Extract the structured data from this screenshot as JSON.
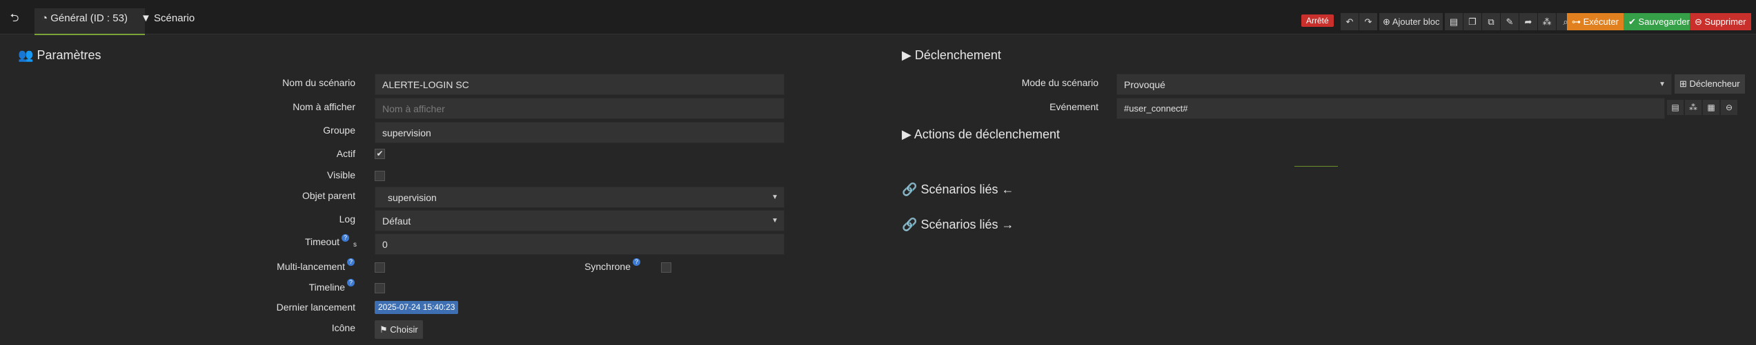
{
  "topbar": {
    "back_icon": "arrow-left-circle-icon",
    "tabs": [
      {
        "label": "Général (ID : 53)",
        "icon": "dashboard-icon"
      },
      {
        "label": "Scénario",
        "icon": "filter-icon"
      }
    ],
    "status": "Arrêté",
    "add_block_label": "Ajouter bloc",
    "execute_label": "Exécuter",
    "save_label": "Sauvegarder",
    "delete_label": "Supprimer"
  },
  "left": {
    "section_title": "Paramètres",
    "fields": {
      "name_label": "Nom du scénario",
      "name_value": "ALERTE-LOGIN SC",
      "display_label": "Nom à afficher",
      "display_placeholder": "Nom à afficher",
      "group_label": "Groupe",
      "group_value": "supervision",
      "active_label": "Actif",
      "active_checked": true,
      "visible_label": "Visible",
      "visible_checked": false,
      "parent_label": "Objet parent",
      "parent_value": "supervision",
      "log_label": "Log",
      "log_value": "Défaut",
      "timeout_label": "Timeout",
      "timeout_unit": "s",
      "timeout_value": "0",
      "multi_label": "Multi-lancement",
      "sync_label": "Synchrone",
      "timeline_label": "Timeline",
      "last_run_label": "Dernier lancement",
      "last_run_value": "2025-07-24 15:40:23",
      "icon_label": "Icône",
      "choose_label": "Choisir"
    }
  },
  "right": {
    "trigger_title": "Déclenchement",
    "mode_label": "Mode du scénario",
    "mode_value": "Provoqué",
    "trigger_button": "Déclencheur",
    "event_label": "Evénement",
    "event_value": "#user_connect#",
    "trigger_actions_title": "Actions de déclenchement",
    "linked_title_1": "Scénarios liés",
    "linked_title_2": "Scénarios liés"
  }
}
